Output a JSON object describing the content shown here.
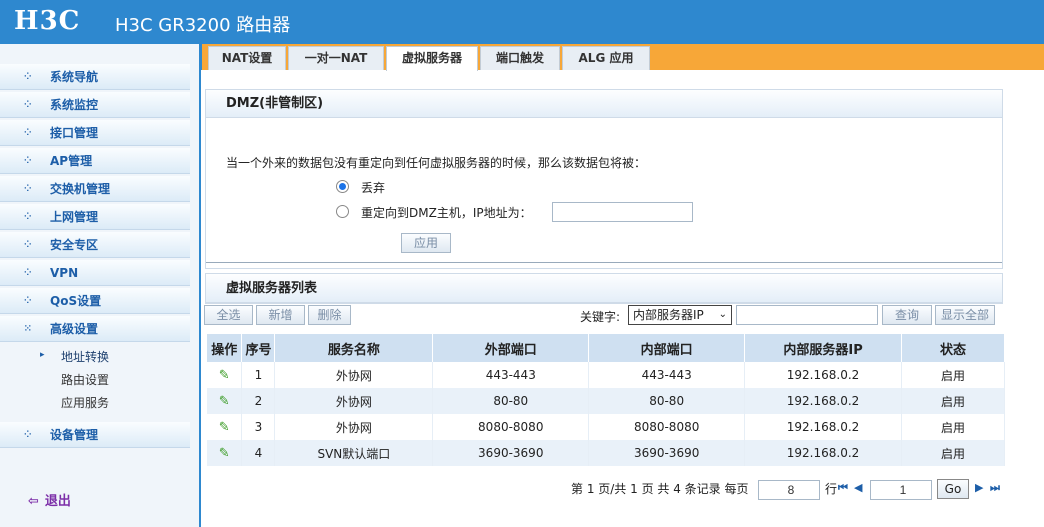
{
  "header": {
    "logo": "H3C",
    "title": "H3C GR3200 路由器"
  },
  "tabs": [
    {
      "label": "NAT设置"
    },
    {
      "label": "一对一NAT"
    },
    {
      "label": "虚拟服务器"
    },
    {
      "label": "端口触发"
    },
    {
      "label": "ALG 应用"
    }
  ],
  "sidebar": {
    "items": [
      {
        "label": "系统导航"
      },
      {
        "label": "系统监控"
      },
      {
        "label": "接口管理"
      },
      {
        "label": "AP管理"
      },
      {
        "label": "交换机管理"
      },
      {
        "label": "上网管理"
      },
      {
        "label": "安全专区"
      },
      {
        "label": "VPN"
      },
      {
        "label": "QoS设置"
      },
      {
        "label": "高级设置"
      },
      {
        "label": "设备管理"
      }
    ],
    "sub_items": [
      {
        "label": "地址转换"
      },
      {
        "label": "路由设置"
      },
      {
        "label": "应用服务"
      }
    ],
    "logout": "退出"
  },
  "dmz": {
    "title": "DMZ(非管制区)",
    "desc": "当一个外来的数据包没有重定向到任何虚拟服务器的时候，那么该数据包将被：",
    "option_drop": "丢弃",
    "option_redirect": "重定向到DMZ主机，IP地址为：",
    "ip_value": "",
    "apply": "应用"
  },
  "vs": {
    "title": "虚拟服务器列表",
    "select_all": "全选",
    "add": "新增",
    "delete": "删除",
    "keyword_label": "关键字:",
    "keyword_selected": "内部服务器IP",
    "search_value": "",
    "query": "查询",
    "show_all": "显示全部",
    "columns": [
      "操作",
      "序号",
      "服务名称",
      "外部端口",
      "内部端口",
      "内部服务器IP",
      "状态"
    ],
    "rows": [
      {
        "no": "1",
        "name": "外协网",
        "ext": "443-443",
        "int": "443-443",
        "ip": "192.168.0.2",
        "status": "启用"
      },
      {
        "no": "2",
        "name": "外协网",
        "ext": "80-80",
        "int": "80-80",
        "ip": "192.168.0.2",
        "status": "启用"
      },
      {
        "no": "3",
        "name": "外协网",
        "ext": "8080-8080",
        "int": "8080-8080",
        "ip": "192.168.0.2",
        "status": "启用"
      },
      {
        "no": "4",
        "name": "SVN默认端口",
        "ext": "3690-3690",
        "int": "3690-3690",
        "ip": "192.168.0.2",
        "status": "启用"
      }
    ]
  },
  "pager": {
    "info": "第 1 页/共 1 页 共 4 条记录 每页",
    "per_page": "8",
    "rows_unit": "行",
    "page": "1",
    "go": "Go"
  }
}
